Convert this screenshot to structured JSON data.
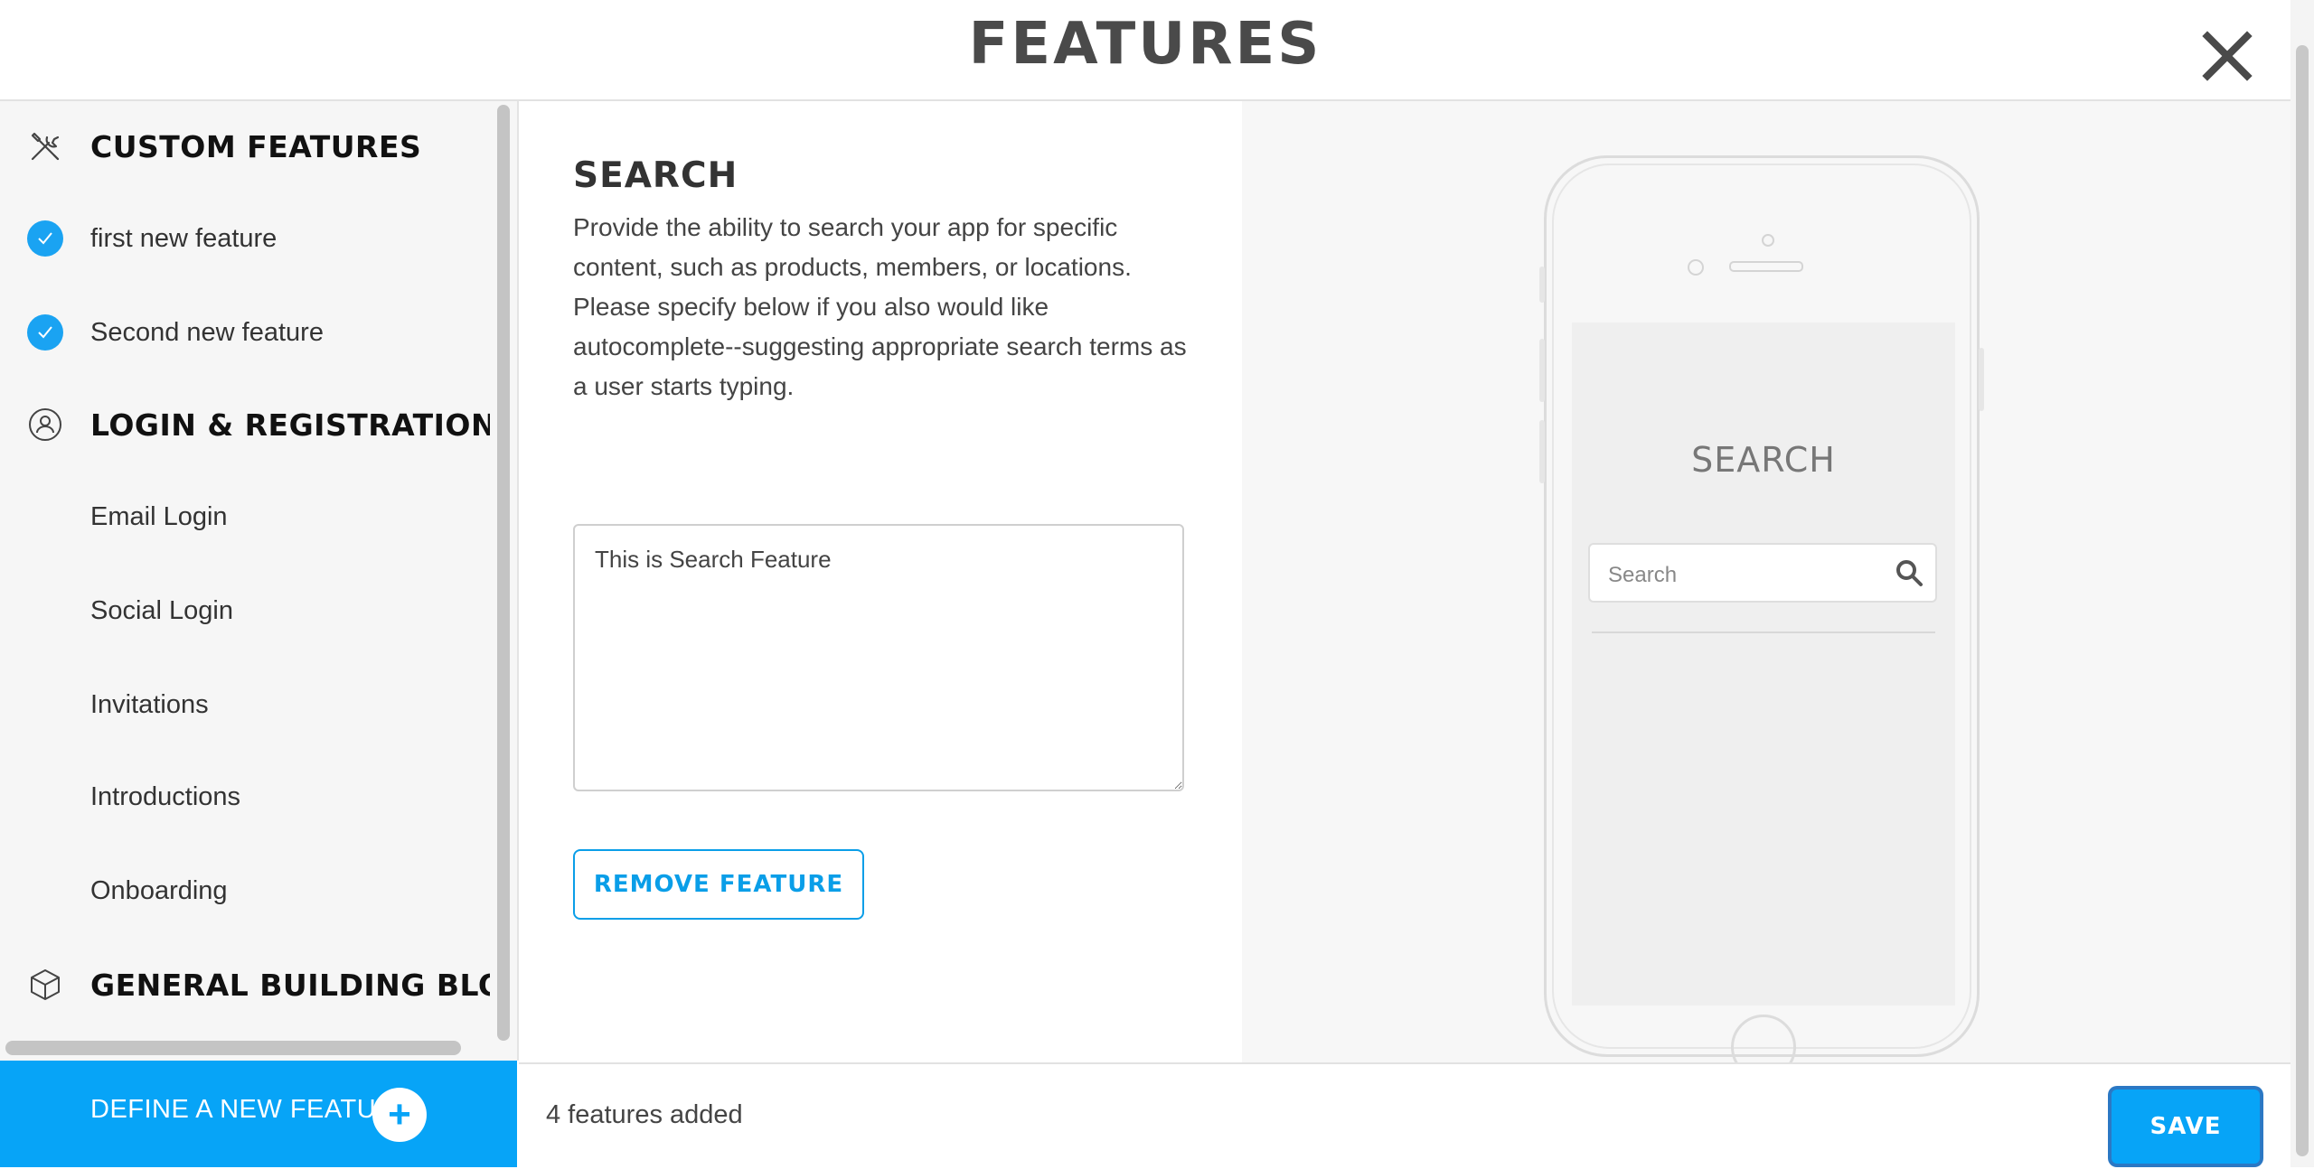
{
  "header": {
    "title": "FEATURES",
    "close_icon": "close-icon"
  },
  "sidebar": {
    "items": [
      {
        "type": "section",
        "icon": "tools-icon",
        "label": "CUSTOM FEATURES"
      },
      {
        "type": "item",
        "checked": true,
        "label": "first new feature"
      },
      {
        "type": "item",
        "checked": true,
        "label": "Second new feature"
      },
      {
        "type": "section",
        "icon": "user-circle-icon",
        "label": "LOGIN & REGISTRATION"
      },
      {
        "type": "item",
        "checked": false,
        "label": "Email Login"
      },
      {
        "type": "item",
        "checked": false,
        "label": "Social Login"
      },
      {
        "type": "item",
        "checked": false,
        "label": "Invitations"
      },
      {
        "type": "item",
        "checked": false,
        "label": "Introductions"
      },
      {
        "type": "item",
        "checked": false,
        "label": "Onboarding"
      },
      {
        "type": "section",
        "icon": "cube-icon",
        "label": "GENERAL BUILDING BLO..."
      }
    ],
    "define_label": "DEFINE A NEW FEATURE",
    "define_icon": "plus-icon"
  },
  "main": {
    "title": "SEARCH",
    "description": "Provide the ability to search your app for specific content, such as products, members, or locations. Please specify below if you also would like autocomplete--suggesting appropriate search terms as a user starts typing.",
    "textarea_value": "This is Search Feature",
    "remove_label": "REMOVE FEATURE"
  },
  "preview": {
    "screen_title": "SEARCH",
    "search_placeholder": "Search",
    "search_icon": "search-icon"
  },
  "footer": {
    "count_text": "4 features added",
    "save_label": "SAVE"
  },
  "colors": {
    "accent": "#07a4f7",
    "check": "#1aa3f2",
    "sidebar_bg": "#f6f6f6",
    "preview_bg": "#f7f7f7"
  }
}
